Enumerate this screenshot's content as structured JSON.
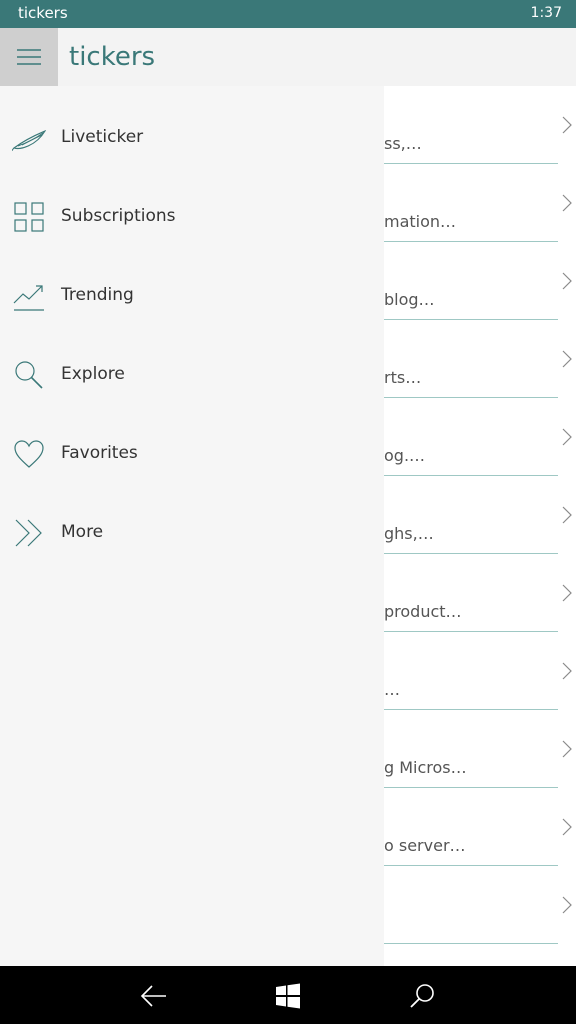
{
  "status_bar": {
    "app_name": "tickers",
    "time": "1:37"
  },
  "header": {
    "title": "tickers",
    "menu_icon": "hamburger-icon"
  },
  "drawer": {
    "items": [
      {
        "label": "Liveticker",
        "icon": "feather-icon"
      },
      {
        "label": "Subscriptions",
        "icon": "grid-icon"
      },
      {
        "label": "Trending",
        "icon": "trend-icon"
      },
      {
        "label": "Explore",
        "icon": "magnifier-icon"
      },
      {
        "label": "Favorites",
        "icon": "heart-icon"
      },
      {
        "label": "More",
        "icon": "double-chevron-icon"
      }
    ]
  },
  "list": {
    "items": [
      {
        "snippet": "ss,…"
      },
      {
        "snippet": "mation…"
      },
      {
        "snippet": "blog…"
      },
      {
        "snippet": "rts…"
      },
      {
        "snippet": "og.…"
      },
      {
        "snippet": "ghs,…"
      },
      {
        "snippet": " product…"
      },
      {
        "snippet": "…"
      },
      {
        "snippet": "g Micros…"
      },
      {
        "snippet": "o server…"
      },
      {
        "snippet": ""
      }
    ]
  },
  "colors": {
    "accent": "#3a7878",
    "status_bar": "#3a7878",
    "divider": "#9fc8c4"
  }
}
